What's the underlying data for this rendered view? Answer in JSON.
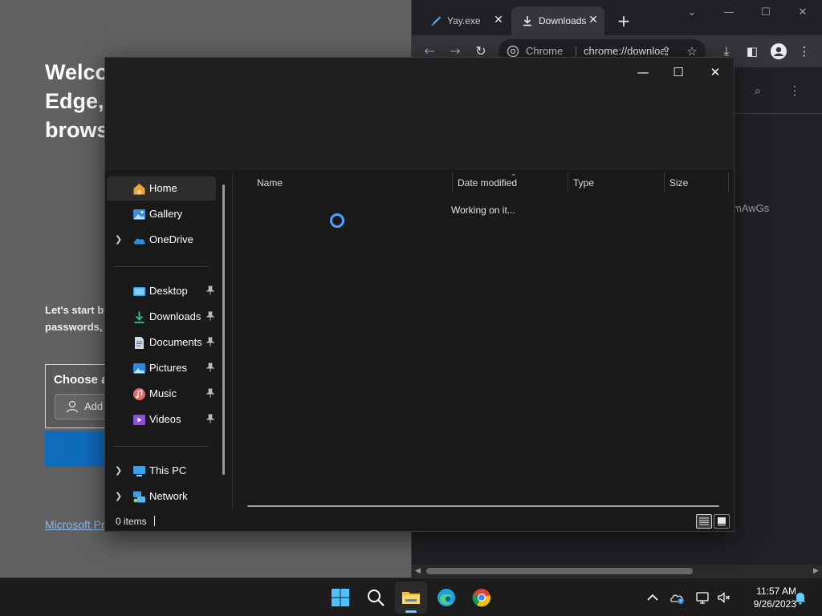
{
  "edge_welcome": {
    "title_lines": [
      "Welcome to Microsoft",
      "Edge, the",
      "browser"
    ],
    "subtitle_lines": [
      "Let's start by",
      "passwords,"
    ],
    "choose_label": "Choose a",
    "add_label": "Add",
    "link_text": "Microsoft Privacy"
  },
  "chrome": {
    "tabs": [
      {
        "label": "Yay.exe",
        "active": false
      },
      {
        "label": "Downloads",
        "active": true
      }
    ],
    "omnibox": {
      "label": "Chrome",
      "url": "chrome://downloads"
    },
    "page_fragment": "mAwGs"
  },
  "explorer": {
    "nav": {
      "home": "Home",
      "gallery": "Gallery",
      "onedrive": "OneDrive",
      "desktop": "Desktop",
      "downloads": "Downloads",
      "documents": "Documents",
      "pictures": "Pictures",
      "music": "Music",
      "videos": "Videos",
      "this_pc": "This PC",
      "network": "Network"
    },
    "columns": {
      "name": "Name",
      "date_modified": "Date modified",
      "type": "Type",
      "size": "Size"
    },
    "status_message": "Working on it...",
    "status_bar": {
      "item_count": "0 items"
    }
  },
  "taskbar": {
    "clock": {
      "time": "11:57 AM",
      "date": "9/26/2023"
    }
  },
  "colors": {
    "accent": "#60cdff",
    "spinner": "#4aa3ff",
    "explorer_bg": "#191919",
    "chrome_bg": "#202124"
  }
}
